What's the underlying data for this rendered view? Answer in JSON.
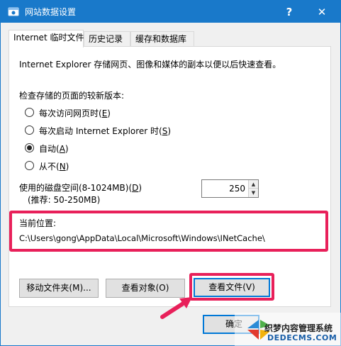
{
  "window": {
    "title": "网站数据设置",
    "help_label": "?",
    "close_label": "✕"
  },
  "tabs": [
    {
      "label": "Internet 临时文件",
      "active": true
    },
    {
      "label": "历史记录",
      "active": false
    },
    {
      "label": "缓存和数据库",
      "active": false
    }
  ],
  "panel": {
    "description": "Internet Explorer 存储网页、图像和媒体的副本以便以后快速查看。",
    "check_heading": "检查存储的页面的较新版本:",
    "radios": [
      {
        "label": "每次访问网页时(",
        "key": "E",
        "suffix": ")",
        "selected": false
      },
      {
        "label": "每次启动 Internet Explorer 时(",
        "key": "S",
        "suffix": ")",
        "selected": false
      },
      {
        "label": "自动(",
        "key": "A",
        "suffix": ")",
        "selected": true
      },
      {
        "label": "从不(",
        "key": "N",
        "suffix": ")",
        "selected": false
      }
    ],
    "disk_label": "使用的磁盘空间(8-1024MB)(",
    "disk_key": "D",
    "disk_suffix": ")",
    "disk_recommend": "(推荐: 50-250MB)",
    "disk_value": "250",
    "location_label": "当前位置:",
    "location_path": "C:\\Users\\gong\\AppData\\Local\\Microsoft\\Windows\\INetCache\\"
  },
  "buttons": {
    "move_folder": "移动文件夹(M)...",
    "view_objects": "查看对象(O)",
    "view_files": "查看文件(V)",
    "ok": "确定"
  },
  "watermark": {
    "line1": "织梦内容管理系统",
    "line2": "DEDECMS.COM"
  },
  "colors": {
    "titlebar": "#1979ca",
    "highlight": "#e8205a",
    "focus": "#0078d7"
  }
}
